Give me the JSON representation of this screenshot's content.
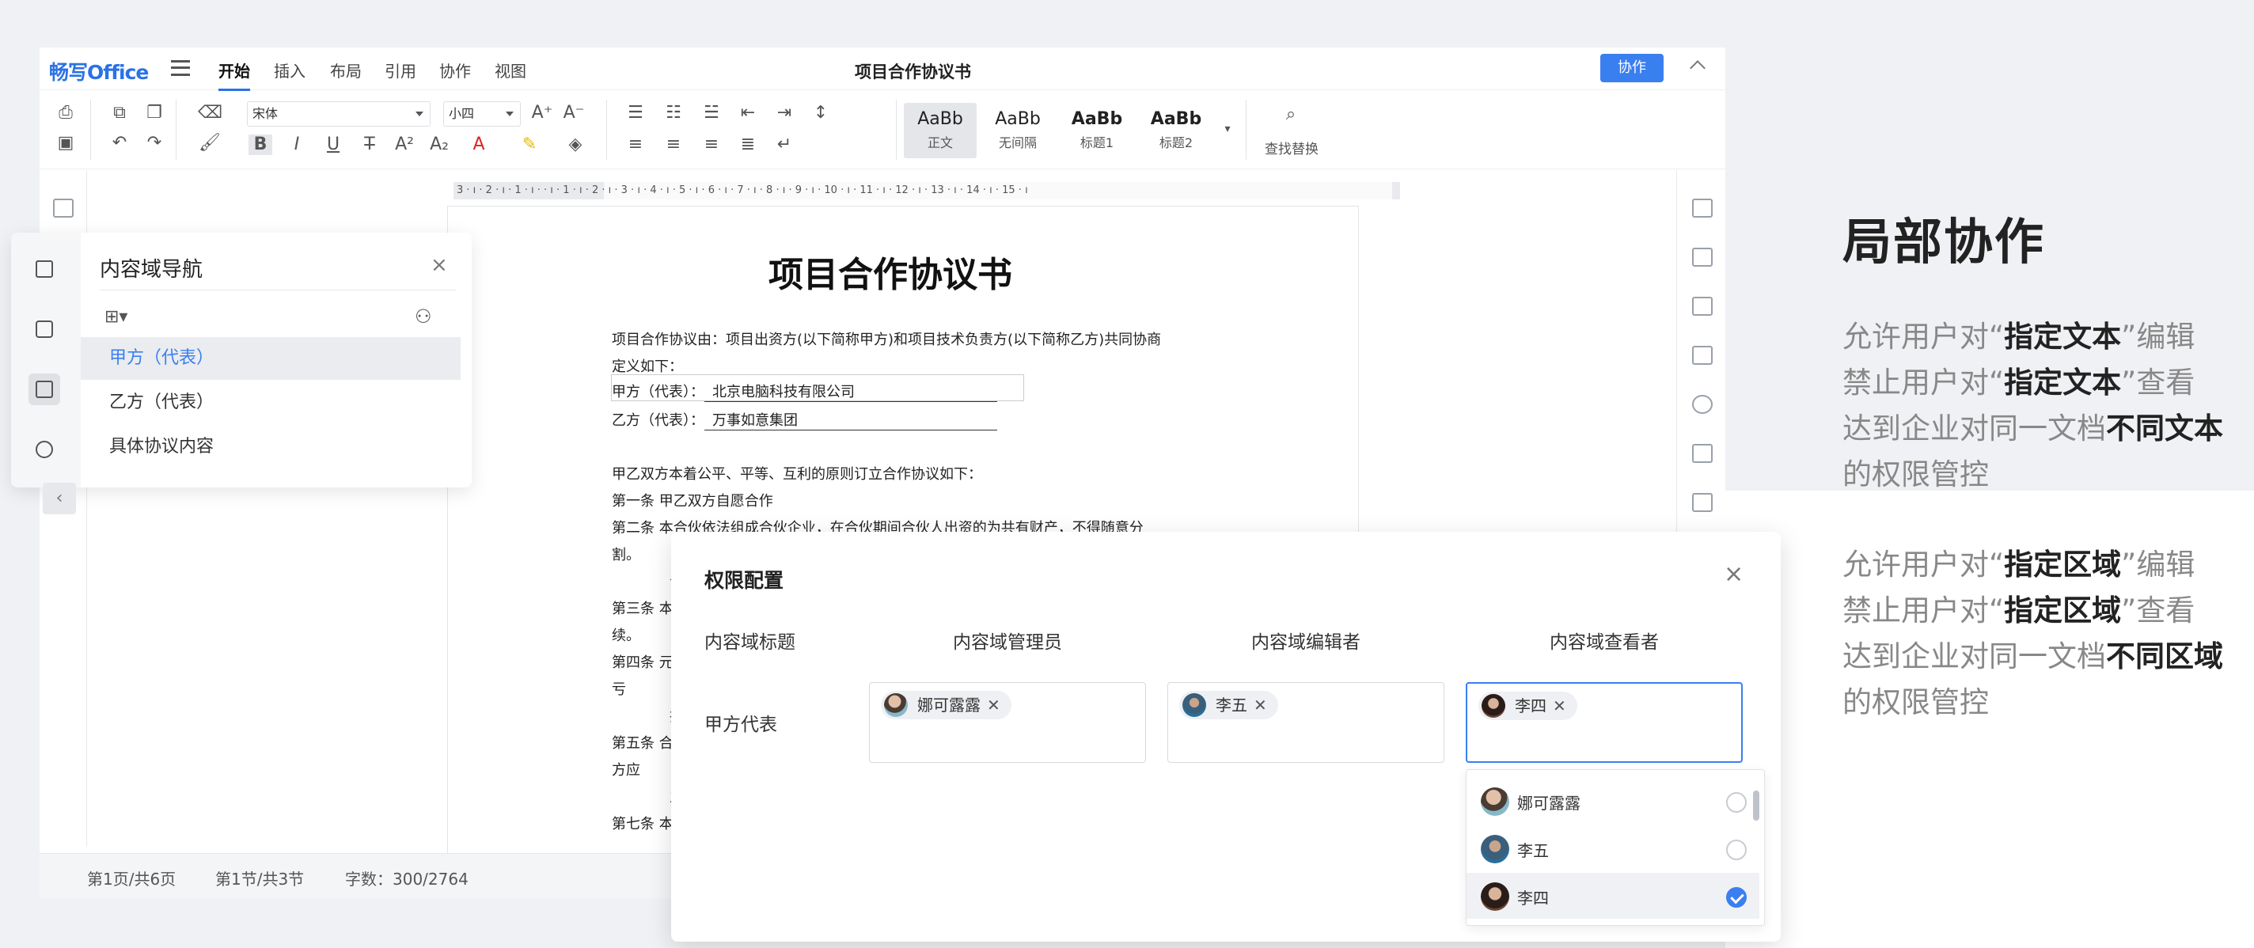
{
  "app": {
    "logo": "畅写Office",
    "tabs": [
      "开始",
      "插入",
      "布局",
      "引用",
      "协作",
      "视图"
    ],
    "doc_title": "项目合作协议书",
    "collab_button": "协作"
  },
  "toolbar": {
    "font_name": "宋体",
    "font_size": "小四",
    "styles": [
      {
        "preview": "AaBb",
        "label": "正文"
      },
      {
        "preview": "AaBb",
        "label": "无间隔"
      },
      {
        "preview": "AaBb",
        "label": "标题1"
      },
      {
        "preview": "AaBb",
        "label": "标题2"
      }
    ],
    "find_replace": "查找替换"
  },
  "ruler_text": "3 · ı · 2 · ı · 1 · ı ·    · ı · 1 · ı · 2 · ı · 3 · ı · 4 · ı · 5 · ı · 6 · ı · 7 · ı · 8 · ı · 9 · ı · 10 · ı · 11 · ı · 12 · ı · 13 · ı · 14 · ı · 15 · ı",
  "document": {
    "title": "项目合作协议书",
    "intro1": "项目合作协议由：项目出资方(以下简称甲方)和项目技术负责方(以下简称乙方)共同协商",
    "intro2": "定义如下：",
    "party_a_label": "甲方（代表）：",
    "party_a_value": "北京电脑科技有限公司",
    "party_b_label": "乙方（代表）：",
    "party_b_value": "万事如意集团",
    "para": "甲乙双方本着公平、平等、互利的原则订立合作协议如下：",
    "art1": "第一条  甲乙双方自愿合作",
    "art2a": "第二条  本合伙依法组成合伙企业，在合伙期间合伙人出资的为共有财产，不得随意分",
    "art2b": "割。",
    "frag1": "合",
    "art3a": "第三条  本",
    "art3b": "续。",
    "art4a": "第四条  元",
    "art4b": "亏",
    "frag2": "护",
    "art5a": "第五条  合",
    "art5b": "方应",
    "frag3": "主",
    "art7": "第七条  本"
  },
  "status": {
    "page": "第1页/共6页",
    "section": "第1节/共3节",
    "words": "字数：300/2764"
  },
  "nav_panel": {
    "title": "内容域导航",
    "close": "×",
    "items": [
      "甲方（代表）",
      "乙方（代表）",
      "具体协议内容"
    ]
  },
  "dialog": {
    "title": "权限配置",
    "close": "×",
    "columns": [
      "内容域标题",
      "内容域管理员",
      "内容域编辑者",
      "内容域查看者"
    ],
    "row_label": "甲方代表",
    "admin_chip": "娜可露露",
    "editor_chip": "李五",
    "viewer_chip": "李四",
    "chip_remove": "✕",
    "dropdown": [
      {
        "name": "娜可露露",
        "checked": false
      },
      {
        "name": "李五",
        "checked": false
      },
      {
        "name": "李四",
        "checked": true
      }
    ]
  },
  "marketing": {
    "title": "局部协作",
    "p1": {
      "l1a": "允许用户对“",
      "l1b": "指定文本",
      "l1c": "”编辑",
      "l2a": "禁止用户对“",
      "l2b": "指定文本",
      "l2c": "”查看",
      "l3a": "达到企业对同一文档",
      "l3b": "不同文本",
      "l4": "的权限管控"
    },
    "p2": {
      "l1a": "允许用户对“",
      "l1b": "指定区域",
      "l1c": "”编辑",
      "l2a": "禁止用户对“",
      "l2b": "指定区域",
      "l2c": "”查看",
      "l3a": "达到企业对同一文档",
      "l3b": "不同区域",
      "l4": "的权限管控"
    }
  },
  "colors": {
    "accent": "#3a7ff0",
    "brand": "#2a72e6"
  }
}
